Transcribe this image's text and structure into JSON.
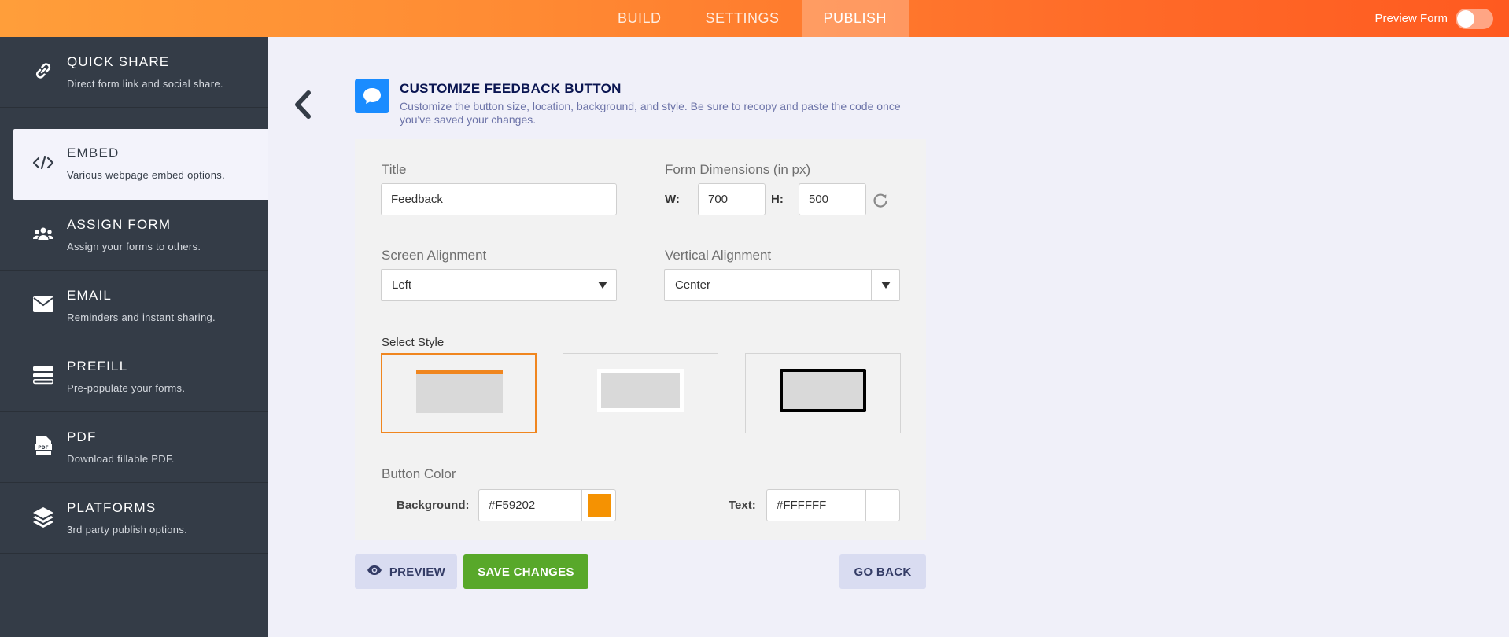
{
  "topbar": {
    "tabs": [
      {
        "label": "BUILD"
      },
      {
        "label": "SETTINGS"
      },
      {
        "label": "PUBLISH",
        "active": true
      }
    ],
    "preview_form_label": "Preview Form",
    "preview_form_on": false
  },
  "sidebar": {
    "items": [
      {
        "title": "QUICK SHARE",
        "subtitle": "Direct form link and social share.",
        "icon": "link-icon"
      },
      {
        "title": "EMBED",
        "subtitle": "Various webpage embed options.",
        "icon": "code-icon",
        "active": true
      },
      {
        "title": "ASSIGN FORM",
        "subtitle": "Assign your forms to others.",
        "icon": "users-icon"
      },
      {
        "title": "EMAIL",
        "subtitle": "Reminders and instant sharing.",
        "icon": "envelope-icon"
      },
      {
        "title": "PREFILL",
        "subtitle": "Pre-populate your forms.",
        "icon": "prefill-icon"
      },
      {
        "title": "PDF",
        "subtitle": "Download fillable PDF.",
        "icon": "pdf-icon"
      },
      {
        "title": "PLATFORMS",
        "subtitle": "3rd party publish options.",
        "icon": "layers-icon"
      }
    ]
  },
  "header": {
    "title": "CUSTOMIZE FEEDBACK BUTTON",
    "description": "Customize the button size, location, background, and style. Be sure to recopy and paste the code once you've saved your changes.",
    "icon": "chat-bubble-icon"
  },
  "form": {
    "title_label": "Title",
    "title_value": "Feedback",
    "dimensions_label": "Form Dimensions (in px)",
    "w_label": "W:",
    "w_value": "700",
    "h_label": "H:",
    "h_value": "500",
    "screen_alignment_label": "Screen Alignment",
    "screen_alignment_value": "Left",
    "vertical_alignment_label": "Vertical Alignment",
    "vertical_alignment_value": "Center",
    "select_style_label": "Select Style",
    "selected_style_index": 0,
    "button_color_label": "Button Color",
    "background_label": "Background:",
    "background_value": "#F59202",
    "text_label": "Text:",
    "text_value": "#FFFFFF"
  },
  "buttons": {
    "preview": "PREVIEW",
    "save": "SAVE CHANGES",
    "go_back": "GO BACK"
  },
  "colors": {
    "accent_orange": "#f0861f",
    "background_swatch": "#F59202",
    "text_swatch": "#FFFFFF",
    "save_green": "#58a82a",
    "sidebar_dark": "#343c47",
    "header_icon_blue": "#1a8cff"
  }
}
